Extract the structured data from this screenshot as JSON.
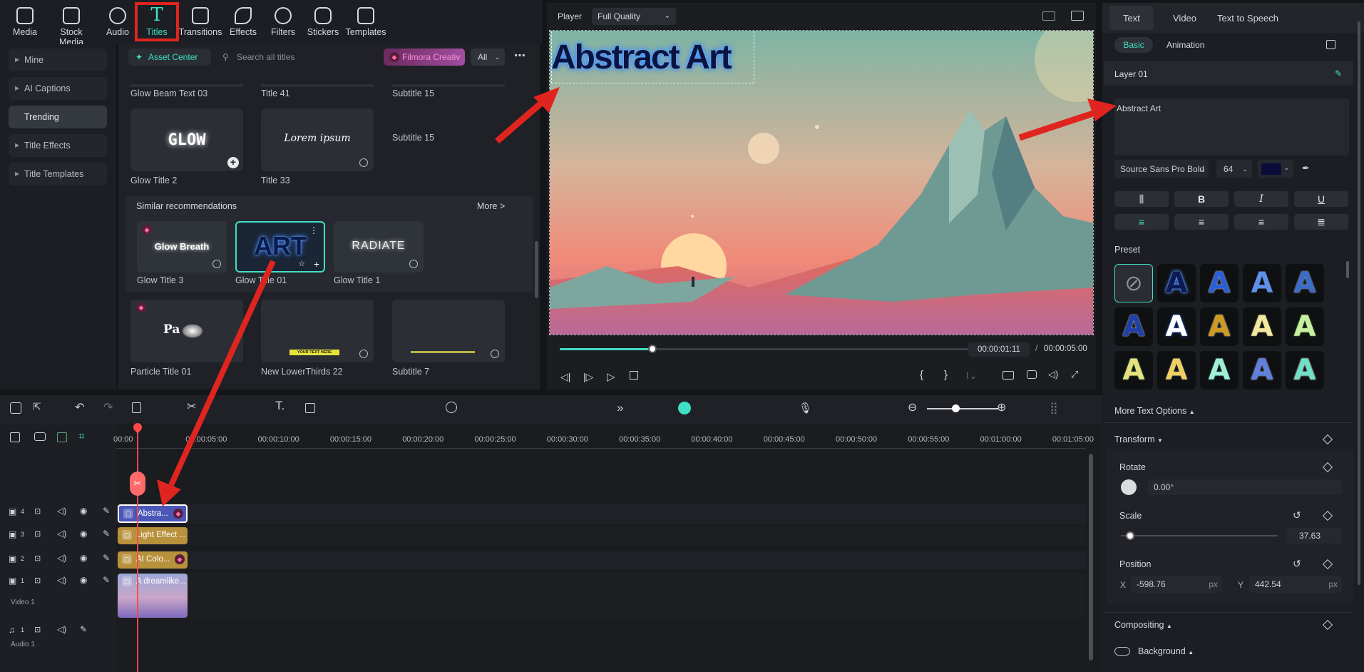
{
  "toolbar": {
    "items": [
      {
        "label": "Media",
        "icon": "media-icon"
      },
      {
        "label": "Stock Media",
        "icon": "stock-media-icon"
      },
      {
        "label": "Audio",
        "icon": "audio-icon"
      },
      {
        "label": "Titles",
        "icon": "titles-icon"
      },
      {
        "label": "Transitions",
        "icon": "transitions-icon"
      },
      {
        "label": "Effects",
        "icon": "effects-icon"
      },
      {
        "label": "Filters",
        "icon": "filters-icon"
      },
      {
        "label": "Stickers",
        "icon": "stickers-icon"
      },
      {
        "label": "Templates",
        "icon": "templates-icon"
      }
    ],
    "active": "Titles"
  },
  "leftnav": {
    "items": [
      "Mine",
      "AI Captions",
      "Trending",
      "Title Effects",
      "Title Templates"
    ],
    "selected": "Trending"
  },
  "assets": {
    "asset_center": "Asset Center",
    "search_placeholder": "Search all titles",
    "promo": "Filmora Creativ",
    "filter": "All",
    "top_row": [
      "Glow Beam Text 03",
      "Title 41",
      "Subtitle 15"
    ],
    "row2": [
      {
        "name": "Glow Title 2",
        "thumb": "GLOW"
      },
      {
        "name": "Title 33",
        "thumb": "Lorem ipsum"
      }
    ],
    "similar_title": "Similar recommendations",
    "more": "More >",
    "similar": [
      {
        "name": "Glow Title 3",
        "thumb": "Glow Breath"
      },
      {
        "name": "Glow Title 01",
        "thumb": "ART"
      },
      {
        "name": "Glow Title 1",
        "thumb": "RADIATE"
      }
    ],
    "row4": [
      {
        "name": "Particle Title 01",
        "thumb": "Pa"
      },
      {
        "name": "New LowerThirds 22",
        "thumb": "YOUR TEXT HERE"
      },
      {
        "name": "Subtitle 7",
        "thumb": ""
      }
    ]
  },
  "player": {
    "label": "Player",
    "quality": "Full Quality",
    "overlay_text": "Abstract Art",
    "time_current": "00:00:01:11",
    "time_sep": "/",
    "time_total": "00:00:05:00",
    "progress": 0.22
  },
  "props": {
    "tabs": [
      "Text",
      "Video",
      "Text to Speech"
    ],
    "subtabs": [
      "Basic",
      "Animation"
    ],
    "layer": "Layer 01",
    "text_value": "Abstract Art",
    "font": "Source Sans Pro Bold",
    "size": "64",
    "color": "#0b0b3a",
    "style_buttons": [
      "B",
      "I",
      "U"
    ],
    "preset_label": "Preset",
    "more_text_options": "More Text Options",
    "transform": "Transform",
    "rotate_label": "Rotate",
    "rotate_value": "0.00°",
    "scale_label": "Scale",
    "scale_value": "37.63",
    "scale_fraction": 0.06,
    "position_label": "Position",
    "x_label": "X",
    "x_value": "-598.76",
    "x_unit": "px",
    "y_label": "Y",
    "y_value": "442.54",
    "y_unit": "px",
    "compositing": "Compositing",
    "background": "Background"
  },
  "timeline": {
    "ticks": [
      "00:00",
      "00:00:05:00",
      "00:00:10:00",
      "00:00:15:00",
      "00:00:20:00",
      "00:00:25:00",
      "00:00:30:00",
      "00:00:35:00",
      "00:00:40:00",
      "00:00:45:00",
      "00:00:50:00",
      "00:00:55:00",
      "00:01:00:00",
      "00:01:05:00"
    ],
    "tracks": [
      {
        "num": "4",
        "clip": "Abstra...",
        "color": "#4a57b8"
      },
      {
        "num": "3",
        "clip": "Light Effect ...",
        "color": "#b8913c"
      },
      {
        "num": "2",
        "clip": "AI Colo...",
        "color": "#b8913c"
      },
      {
        "num": "1",
        "clip": "A dreamlike...",
        "label": "Video 1",
        "color": "#6f6bb0"
      }
    ],
    "audio": {
      "num": "1",
      "label": "Audio 1"
    }
  }
}
